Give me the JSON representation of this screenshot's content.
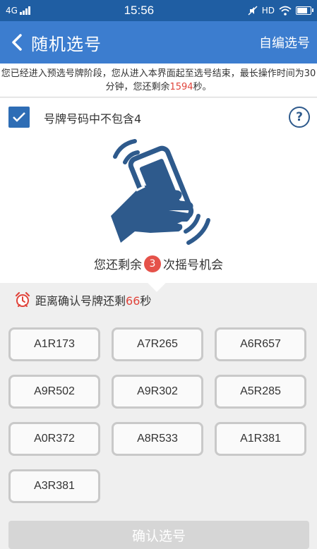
{
  "status_bar": {
    "network": "4G",
    "time": "15:56",
    "hd": "HD"
  },
  "header": {
    "back_icon": "chevron-left-icon",
    "title": "随机选号",
    "action": "自编选号"
  },
  "info": {
    "text_before": "您已经进入预选号牌阶段，您从进入本界面起至选号结束，最长操作时间为30分钟，您还剩余",
    "seconds": "1594",
    "text_after": "秒。"
  },
  "filter": {
    "checked": true,
    "label": "号牌号码中不包含4"
  },
  "shake": {
    "remaining_prefix": "您还剩余",
    "remaining_count": "3",
    "remaining_suffix": "次摇号机会"
  },
  "countdown": {
    "prefix": "距离确认号牌还剩",
    "seconds": "66",
    "suffix": "秒"
  },
  "plates": [
    "A1R173",
    "A7R265",
    "A6R657",
    "A9R502",
    "A9R302",
    "A5R285",
    "A0R372",
    "A8R533",
    "A1R381",
    "A3R381"
  ],
  "confirm_label": "确认选号",
  "colors": {
    "status_bar": "#1f5ea3",
    "header": "#3c7dcf",
    "accent_red": "#e0443b",
    "icon_blue": "#2e5a8c"
  }
}
